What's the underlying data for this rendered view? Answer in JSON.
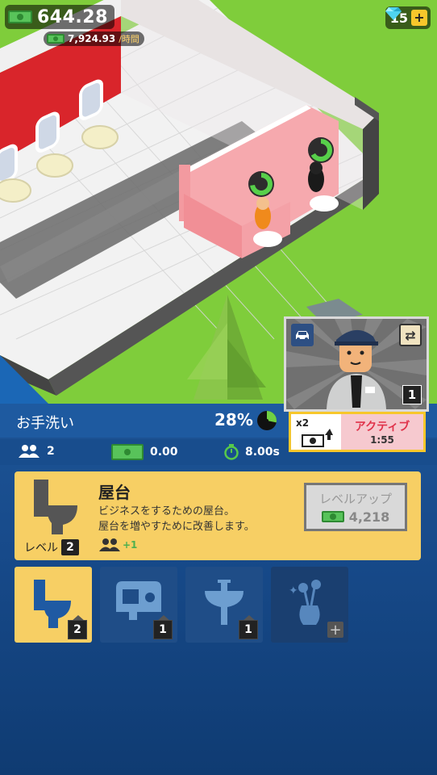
{
  "hud": {
    "money": "644.28",
    "rate": "7,924.93",
    "rate_unit": "/時間",
    "gems": "15",
    "gems_plus": "+"
  },
  "manager": {
    "level": "1",
    "boost_multiplier": "x2",
    "boost_label": "アクティブ",
    "boost_time": "1:55"
  },
  "room": {
    "title": "お手洗い",
    "progress_percent": "28%",
    "progress_fraction": 0.28,
    "customers": "2",
    "income": "0.00",
    "time": "8.00s"
  },
  "item": {
    "name": "屋台",
    "desc_line1": "ビジネスをするための屋台。",
    "desc_line2": "屋台を増やすために改善します。",
    "level_label": "レベル",
    "level": "2",
    "capacity_bonus": "+1",
    "upgrade_label": "レベルアップ",
    "upgrade_cost": "4,218"
  },
  "slots": [
    {
      "icon": "toilet-icon",
      "level": "2",
      "selected": true
    },
    {
      "icon": "hand-dryer-icon",
      "level": "1",
      "selected": false
    },
    {
      "icon": "sink-icon",
      "level": "1",
      "selected": false
    },
    {
      "icon": "flower-vase-icon",
      "level": "",
      "selected": false,
      "locked": true
    }
  ],
  "colors": {
    "accent_yellow": "#f7cf64",
    "panel_blue": "#1e5aa0",
    "cash_green": "#58c35a",
    "active_red": "#e0324a"
  }
}
